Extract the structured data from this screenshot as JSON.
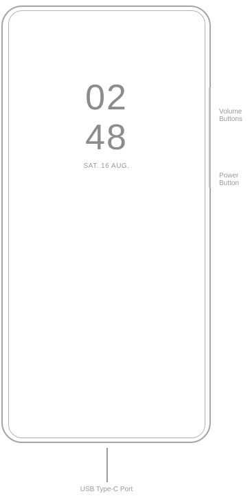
{
  "lock_screen": {
    "hour": "02",
    "minute": "48",
    "date": "SAT. 16  AUG."
  },
  "labels": {
    "volume": "Volume\nButtons",
    "power": "Power\nButton",
    "usb": "USB Type-C Port"
  },
  "colors": {
    "outline": "#a4a4a4",
    "text": "#9a9a9a"
  }
}
